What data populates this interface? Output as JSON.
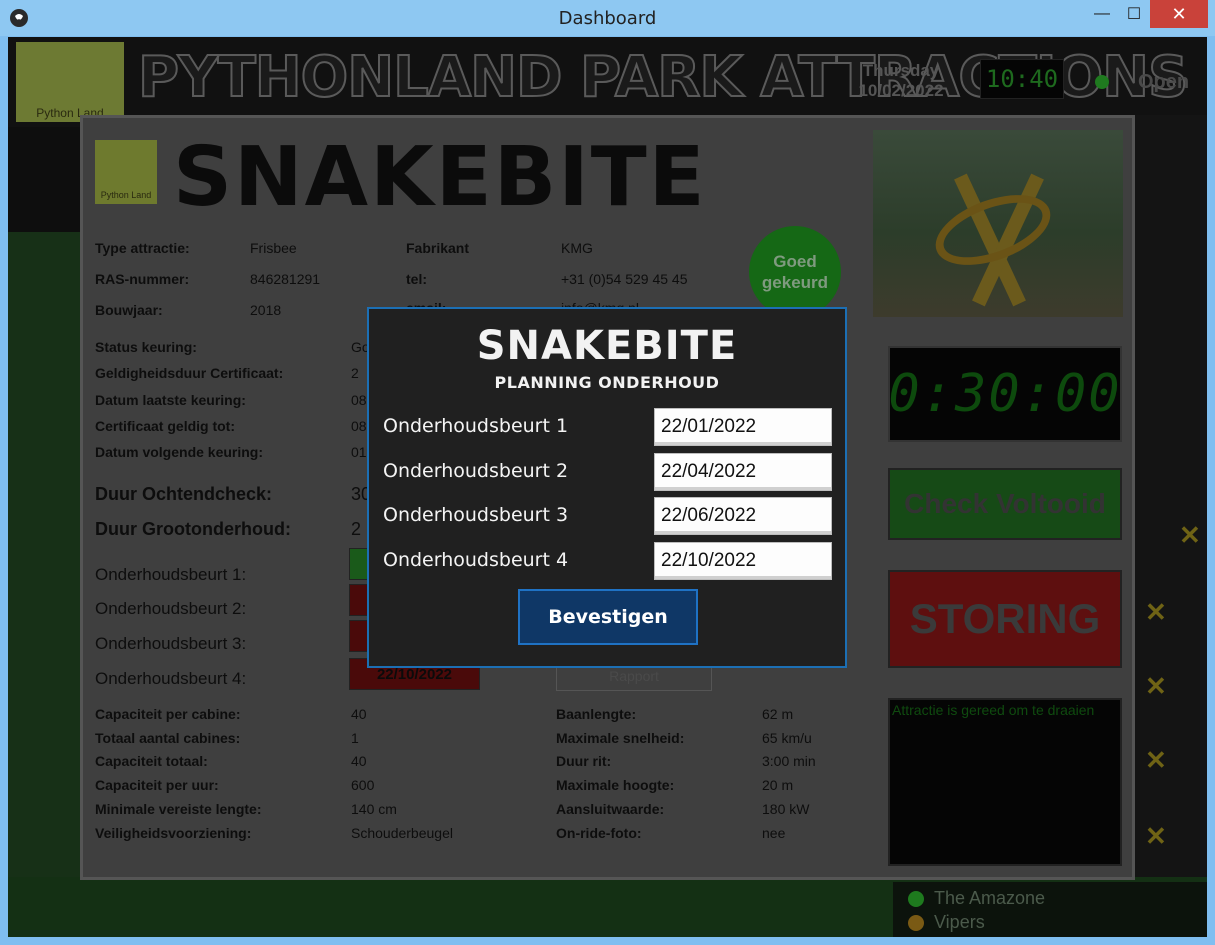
{
  "window": {
    "title": "Dashboard",
    "min_glyph": "—",
    "max_glyph": "☐",
    "close_glyph": "✕"
  },
  "background": {
    "logo_text": "Python Land",
    "banner": "PYTHONLAND PARK ATTRACTIONS",
    "day": "Thursday",
    "date": "10/02/2022",
    "clock": "10:40",
    "park_status": "Open",
    "status_color": "#1f7a1f",
    "list_items": [
      {
        "name": "The Amazone",
        "color": "#1e7a1e"
      },
      {
        "name": "Vipers",
        "color": "#7a5a14"
      }
    ]
  },
  "panel": {
    "logo_text": "Python Land",
    "title": "SNAKEBITE",
    "badge": [
      "Goed",
      "gekeurd"
    ],
    "info_left": [
      {
        "label": "Type attractie:",
        "value": "Frisbee"
      },
      {
        "label": "RAS-nummer:",
        "value": "846281291"
      },
      {
        "label": "Bouwjaar:",
        "value": "2018"
      }
    ],
    "info_right": [
      {
        "label": "Fabrikant",
        "value": "KMG"
      },
      {
        "label": "tel:",
        "value": "+31 (0)54 529 45 45"
      },
      {
        "label": "email:",
        "value": "info@kmg.nl"
      }
    ],
    "inspection": [
      {
        "label": "Status keuring:",
        "value": "Go"
      },
      {
        "label": "Geldigheidsduur Certificaat:",
        "value": "2"
      },
      {
        "label": "Datum laatste keuring:",
        "value": "08"
      },
      {
        "label": "Certificaat geldig tot:",
        "value": "08"
      },
      {
        "label": "Datum volgende keuring:",
        "value": "01"
      }
    ],
    "durations": [
      {
        "label": "Duur Ochtendcheck:",
        "value": "30"
      },
      {
        "label": "Duur Grootonderhoud:",
        "value": "2"
      }
    ],
    "maintenance": [
      {
        "label": "Onderhoudsbeurt 1:"
      },
      {
        "label": "Onderhoudsbeurt 2:"
      },
      {
        "label": "Onderhoudsbeurt 3:"
      },
      {
        "label": "Onderhoudsbeurt 4:"
      }
    ],
    "maintenance4_date": "22/10/2022",
    "rapport_label": "Rapport",
    "specs_left": [
      {
        "label": "Capaciteit per cabine:",
        "value": "40"
      },
      {
        "label": "Totaal aantal cabines:",
        "value": "1"
      },
      {
        "label": "Capaciteit totaal:",
        "value": "40"
      },
      {
        "label": "Capaciteit per uur:",
        "value": "600"
      },
      {
        "label": "Minimale vereiste lengte:",
        "value": "140 cm"
      },
      {
        "label": "Veiligheidsvoorziening:",
        "value": "Schouderbeugel"
      }
    ],
    "specs_right": [
      {
        "label": "Baanlengte:",
        "value": "62 m"
      },
      {
        "label": "Maximale snelheid:",
        "value": "65 km/u"
      },
      {
        "label": "Duur rit:",
        "value": "3:00 min"
      },
      {
        "label": "Maximale hoogte:",
        "value": "20 m"
      },
      {
        "label": "Aansluitwaarde:",
        "value": "180 kW"
      },
      {
        "label": "On-ride-foto:",
        "value": "nee"
      }
    ],
    "timer": "0:30:00",
    "check_label": "Check Voltooid",
    "storing_label": "STORING",
    "log_text": "Attractie is gereed om te draaien"
  },
  "modal": {
    "title": "SNAKEBITE",
    "subtitle": "PLANNING ONDERHOUD",
    "rows": [
      {
        "label": "Onderhoudsbeurt 1",
        "value": "22/01/2022"
      },
      {
        "label": "Onderhoudsbeurt 2",
        "value": "22/04/2022"
      },
      {
        "label": "Onderhoudsbeurt 3",
        "value": "22/06/2022"
      },
      {
        "label": "Onderhoudsbeurt 4",
        "value": "22/10/2022"
      }
    ],
    "confirm_label": "Bevestigen"
  }
}
